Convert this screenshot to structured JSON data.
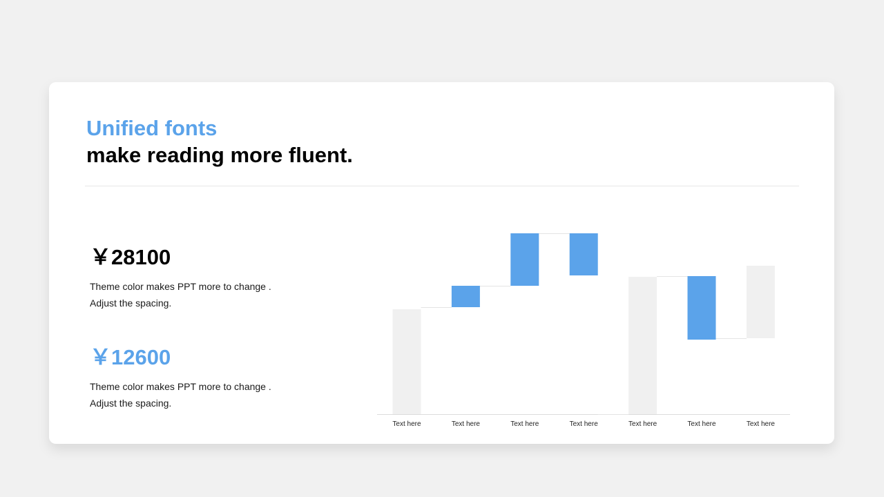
{
  "header": {
    "accent_title": "Unified fonts",
    "main_title": "make reading more fluent."
  },
  "stats": [
    {
      "value": "￥28100",
      "desc_line1": "Theme  color makes PPT more to change .",
      "desc_line2": "Adjust the spacing."
    },
    {
      "value": "￥12600",
      "desc_line1": "Theme  color makes PPT more to change .",
      "desc_line2": "Adjust the spacing."
    }
  ],
  "colors": {
    "accent": "#5ba3ea",
    "total_bar": "#f0f0f0",
    "background": "#f1f1f1",
    "card": "#ffffff"
  },
  "chart_data": {
    "type": "bar",
    "variant": "waterfall",
    "categories": [
      "Text here",
      "Text here",
      "Text here",
      "Text here",
      "Text here",
      "Text here",
      "Text here"
    ],
    "bars": [
      {
        "kind": "total",
        "start": 0,
        "end": 152
      },
      {
        "kind": "change",
        "start": 155,
        "end": 186
      },
      {
        "kind": "change",
        "start": 186,
        "end": 262
      },
      {
        "kind": "change",
        "start": 262,
        "end": 201
      },
      {
        "kind": "total",
        "start": 0,
        "end": 199
      },
      {
        "kind": "change",
        "start": 200,
        "end": 108
      },
      {
        "kind": "total",
        "start": 110,
        "end": 215
      }
    ],
    "ylim": [
      0,
      265
    ],
    "grid": false,
    "legend": "none",
    "title": "",
    "xlabel": "",
    "ylabel": ""
  }
}
